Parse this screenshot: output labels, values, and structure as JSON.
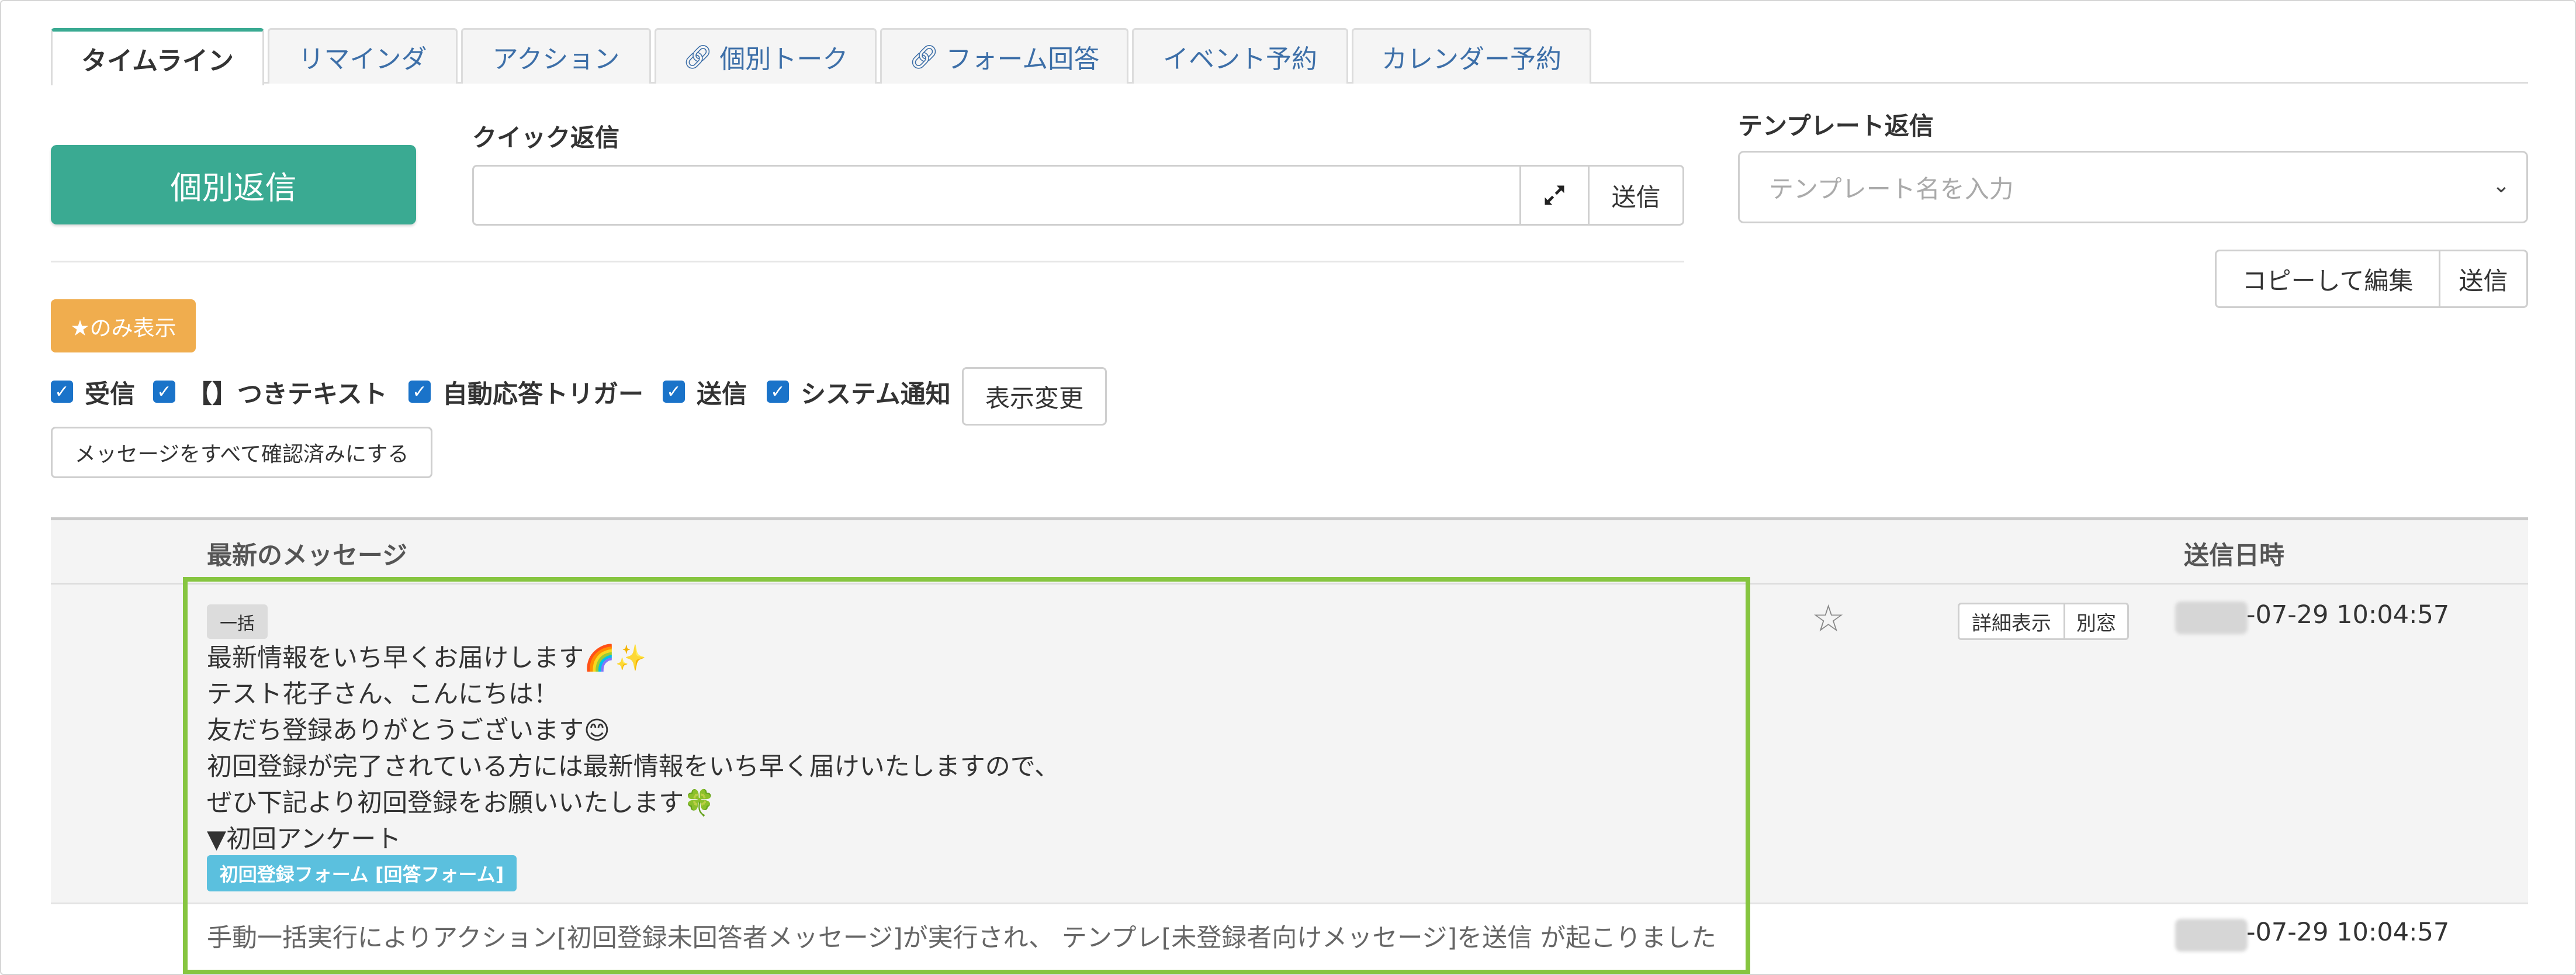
{
  "tabs": [
    {
      "label": "タイムライン",
      "active": true,
      "link_icon": false
    },
    {
      "label": "リマインダ",
      "active": false,
      "link_icon": false
    },
    {
      "label": "アクション",
      "active": false,
      "link_icon": false
    },
    {
      "label": "個別トーク",
      "active": false,
      "link_icon": true
    },
    {
      "label": "フォーム回答",
      "active": false,
      "link_icon": true
    },
    {
      "label": "イベント予約",
      "active": false,
      "link_icon": false
    },
    {
      "label": "カレンダー予約",
      "active": false,
      "link_icon": false
    }
  ],
  "reply": {
    "individual_button": "個別返信",
    "quick_label": "クイック返信",
    "quick_value": "",
    "quick_send": "送信"
  },
  "template": {
    "label": "テンプレート返信",
    "placeholder": "テンプレート名を入力",
    "copy_edit": "コピーして編集",
    "send": "送信"
  },
  "filters": {
    "star_only": "★のみ表示",
    "checkboxes": [
      {
        "label": "受信",
        "checked": true
      },
      {
        "label": "【】つきテキスト",
        "checked": true
      },
      {
        "label": "自動応答トリガー",
        "checked": true
      },
      {
        "label": "送信",
        "checked": true
      },
      {
        "label": "システム通知",
        "checked": true
      }
    ],
    "display_change": "表示変更",
    "mark_all_read": "メッセージをすべて確認済みにする"
  },
  "table": {
    "headers": {
      "message": "最新のメッセージ",
      "sent_at": "送信日時"
    },
    "rows": [
      {
        "badge": "一括",
        "lines": [
          "最新情報をいち早くお届けします🌈✨",
          "テスト花子さん、こんにちは！",
          "友だち登録ありがとうございます😊",
          "初回登録が完了されている方には最新情報をいち早く届けいたしますので、",
          "ぜひ下記より初回登録をお願いいたします🍀",
          "▼初回アンケート"
        ],
        "form_tag": "初回登録フォーム [回答フォーム]",
        "detail_button": "詳細表示",
        "popup_button": "別窓",
        "date": "-07-29 10:04:57",
        "starred": false
      },
      {
        "message": "手動一括実行によりアクション[初回登録未回答者メッセージ]が実行され、 テンプレ[未登録者向けメッセージ]を送信 が起こりました",
        "date": "-07-29 10:04:57"
      }
    ]
  },
  "colors": {
    "primary": "#3aaa92",
    "warning": "#f0ad4e",
    "info": "#5bc0de",
    "checkbox": "#1a73c9",
    "highlight": "#86c540",
    "link": "#3d6fa8"
  },
  "icons": {
    "expand": "expand-icon",
    "link": "link-icon",
    "chevron": "chevron-down-icon",
    "star": "star-outline-icon"
  }
}
